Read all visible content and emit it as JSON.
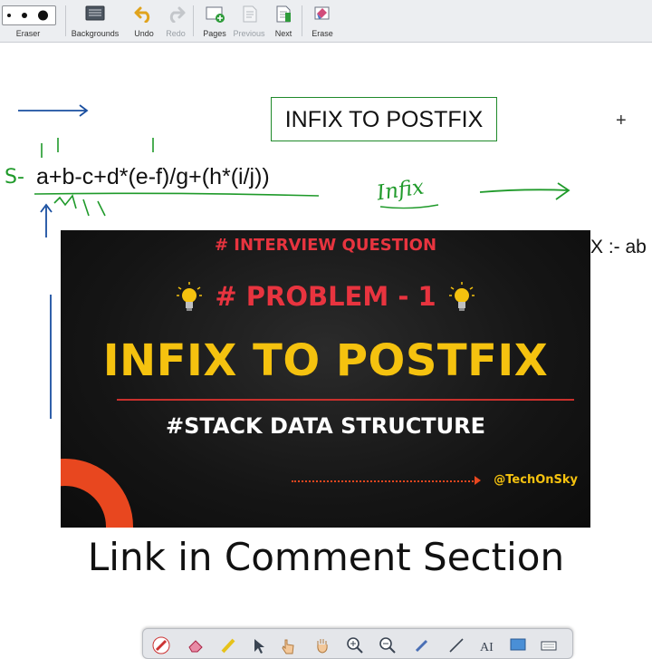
{
  "toolbar": {
    "items": [
      {
        "label": "Eraser",
        "icon": "eraser-size-icon",
        "enabled": true
      },
      {
        "label": "Backgrounds",
        "icon": "backgrounds-icon",
        "enabled": true
      },
      {
        "label": "Undo",
        "icon": "undo-icon",
        "enabled": true
      },
      {
        "label": "Redo",
        "icon": "redo-icon",
        "enabled": false
      },
      {
        "label": "Pages",
        "icon": "pages-icon",
        "enabled": true
      },
      {
        "label": "Previous",
        "icon": "previous-page-icon",
        "enabled": false
      },
      {
        "label": "Next",
        "icon": "next-page-icon",
        "enabled": true
      },
      {
        "label": "Erase",
        "icon": "erase-all-icon",
        "enabled": true
      }
    ]
  },
  "board": {
    "title": "INFIX TO POSTFIX",
    "expression": "a+b-c+d*(e-f)/g+(h*(i/j))",
    "s_label": "S-",
    "infix_note": "Infix",
    "postfix_partial": "X :- ab",
    "ink_color": "#1f9a2a",
    "arrow_color": "#1a4fa0"
  },
  "thumbnail": {
    "tag": "# INTERVIEW QUESTION",
    "problem": "# PROBLEM - 1",
    "title": "INFIX TO POSTFIX",
    "subtitle": "#STACK DATA STRUCTURE",
    "handle": "@TechOnSky",
    "colors": {
      "red": "#e8343f",
      "yellow": "#f5c20f",
      "orange": "#e8471f"
    }
  },
  "caption": "Link in Comment Section",
  "palette": {
    "tools": [
      "pen-icon",
      "eraser-icon",
      "highlighter-icon",
      "pointer-icon",
      "hand-pointer-icon",
      "pan-hand-icon",
      "zoom-in-icon",
      "zoom-out-icon",
      "marker-icon",
      "line-icon",
      "text-icon",
      "screen-icon",
      "keyboard-icon"
    ]
  }
}
